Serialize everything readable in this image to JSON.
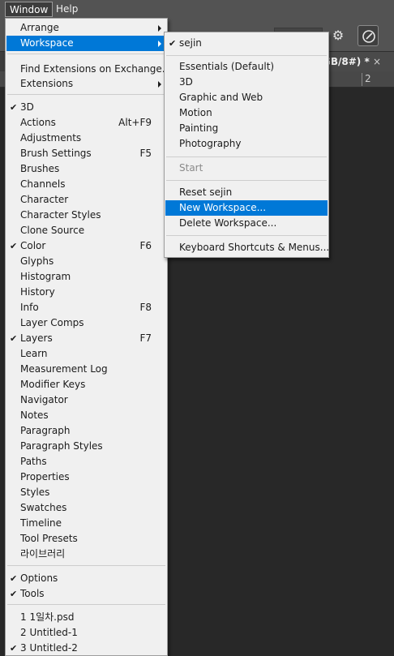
{
  "menubar": {
    "window": "Window",
    "help": "Help"
  },
  "document_tab": {
    "title": "GB/8#) *",
    "close": "×"
  },
  "ruler": {
    "mark": "2"
  },
  "window_menu": {
    "items": [
      {
        "label": "Arrange",
        "shortcut": "",
        "checked": false,
        "submenu": true
      },
      {
        "label": "Workspace",
        "shortcut": "",
        "checked": false,
        "submenu": true,
        "highlighted": true
      },
      {
        "label": "Find Extensions on Exchange...",
        "shortcut": "",
        "checked": false
      },
      {
        "label": "Extensions",
        "shortcut": "",
        "checked": false,
        "submenu": true
      },
      {
        "label": "3D",
        "shortcut": "",
        "checked": true
      },
      {
        "label": "Actions",
        "shortcut": "Alt+F9",
        "checked": false
      },
      {
        "label": "Adjustments",
        "shortcut": "",
        "checked": false
      },
      {
        "label": "Brush Settings",
        "shortcut": "F5",
        "checked": false
      },
      {
        "label": "Brushes",
        "shortcut": "",
        "checked": false
      },
      {
        "label": "Channels",
        "shortcut": "",
        "checked": false
      },
      {
        "label": "Character",
        "shortcut": "",
        "checked": false
      },
      {
        "label": "Character Styles",
        "shortcut": "",
        "checked": false
      },
      {
        "label": "Clone Source",
        "shortcut": "",
        "checked": false
      },
      {
        "label": "Color",
        "shortcut": "F6",
        "checked": true
      },
      {
        "label": "Glyphs",
        "shortcut": "",
        "checked": false
      },
      {
        "label": "Histogram",
        "shortcut": "",
        "checked": false
      },
      {
        "label": "History",
        "shortcut": "",
        "checked": false
      },
      {
        "label": "Info",
        "shortcut": "F8",
        "checked": false
      },
      {
        "label": "Layer Comps",
        "shortcut": "",
        "checked": false
      },
      {
        "label": "Layers",
        "shortcut": "F7",
        "checked": true
      },
      {
        "label": "Learn",
        "shortcut": "",
        "checked": false
      },
      {
        "label": "Measurement Log",
        "shortcut": "",
        "checked": false
      },
      {
        "label": "Modifier Keys",
        "shortcut": "",
        "checked": false
      },
      {
        "label": "Navigator",
        "shortcut": "",
        "checked": false
      },
      {
        "label": "Notes",
        "shortcut": "",
        "checked": false
      },
      {
        "label": "Paragraph",
        "shortcut": "",
        "checked": false
      },
      {
        "label": "Paragraph Styles",
        "shortcut": "",
        "checked": false
      },
      {
        "label": "Paths",
        "shortcut": "",
        "checked": false
      },
      {
        "label": "Properties",
        "shortcut": "",
        "checked": false
      },
      {
        "label": "Styles",
        "shortcut": "",
        "checked": false
      },
      {
        "label": "Swatches",
        "shortcut": "",
        "checked": false
      },
      {
        "label": "Timeline",
        "shortcut": "",
        "checked": false
      },
      {
        "label": "Tool Presets",
        "shortcut": "",
        "checked": false
      },
      {
        "label": "라이브러리",
        "shortcut": "",
        "checked": false
      },
      {
        "label": "Options",
        "shortcut": "",
        "checked": true
      },
      {
        "label": "Tools",
        "shortcut": "",
        "checked": true
      },
      {
        "label": "1 1일차.psd",
        "shortcut": "",
        "checked": false
      },
      {
        "label": "2 Untitled-1",
        "shortcut": "",
        "checked": false
      },
      {
        "label": "3 Untitled-2",
        "shortcut": "",
        "checked": true
      }
    ]
  },
  "workspace_menu": {
    "items": [
      {
        "label": "sejin",
        "checked": true
      },
      {
        "label": "Essentials (Default)",
        "checked": false
      },
      {
        "label": "3D",
        "checked": false
      },
      {
        "label": "Graphic and Web",
        "checked": false
      },
      {
        "label": "Motion",
        "checked": false
      },
      {
        "label": "Painting",
        "checked": false
      },
      {
        "label": "Photography",
        "checked": false
      },
      {
        "label": "Start",
        "checked": false,
        "disabled": true
      },
      {
        "label": "Reset sejin",
        "checked": false
      },
      {
        "label": "New Workspace...",
        "checked": false,
        "highlighted": true
      },
      {
        "label": "Delete Workspace...",
        "checked": false
      },
      {
        "label": "Keyboard Shortcuts & Menus...",
        "checked": false
      }
    ]
  },
  "colors": {
    "highlight": "#0078d7",
    "menu_bg": "#f0f0f0",
    "app_bg": "#262626"
  }
}
